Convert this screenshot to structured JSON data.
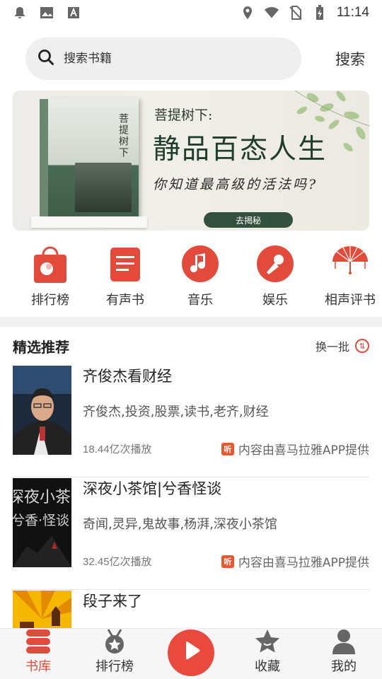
{
  "status_bar": {
    "time": "11:14",
    "left_icons": [
      "notification-bell-icon",
      "image-icon",
      "text-a-icon"
    ],
    "right_icons": [
      "location-icon",
      "wifi-icon",
      "no-sim-icon",
      "battery-charging-icon"
    ]
  },
  "search": {
    "placeholder": "搜索书籍",
    "button_label": "搜索"
  },
  "banner": {
    "subtitle": "菩提树下:",
    "title": "静品百态人生",
    "line": "你知道最高级的活法吗?",
    "button_label": "去揭秘",
    "book_title": "菩提树下"
  },
  "categories": [
    {
      "label": "排行榜",
      "icon": "ranking-bag-icon"
    },
    {
      "label": "有声书",
      "icon": "audiobook-icon"
    },
    {
      "label": "音乐",
      "icon": "music-note-icon"
    },
    {
      "label": "娱乐",
      "icon": "microphone-icon"
    },
    {
      "label": "相声评书",
      "icon": "fan-icon"
    }
  ],
  "recommend": {
    "title": "精选推荐",
    "refresh_label": "换一批",
    "items": [
      {
        "title": "齐俊杰看财经",
        "tags": "齐俊杰,投资,股票,读书,老齐,财经",
        "plays": "18.44亿次播放",
        "source": "内容由喜马拉雅APP提供"
      },
      {
        "title": "深夜小茶馆|兮香怪谈",
        "tags": "奇闻,灵异,鬼故事,杨湃,深夜小茶馆",
        "plays": "32.45亿次播放",
        "source": "内容由喜马拉雅APP提供",
        "thumb_text": "深夜小茶馆",
        "thumb_sub": "兮香·怪谈"
      },
      {
        "title": "段子来了",
        "tags": "",
        "plays": "",
        "source": ""
      }
    ],
    "source_badge": "听"
  },
  "bottom_nav": {
    "tabs": [
      {
        "label": "书库",
        "icon": "bookshelf-icon",
        "active": true
      },
      {
        "label": "排行榜",
        "icon": "medal-icon",
        "active": false
      },
      {
        "label": "",
        "icon": "play-icon",
        "active": false
      },
      {
        "label": "收藏",
        "icon": "star-icon",
        "active": false
      },
      {
        "label": "我的",
        "icon": "user-icon",
        "active": false
      }
    ]
  },
  "colors": {
    "accent": "#e24b3b",
    "banner_button": "#33503f"
  }
}
